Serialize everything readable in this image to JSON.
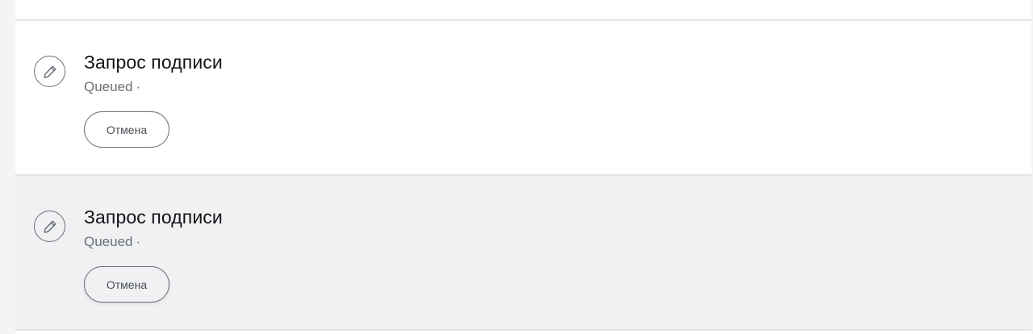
{
  "requests": [
    {
      "title": "Запрос подписи",
      "status": "Queued",
      "separator": "·",
      "cancel_label": "Отмена",
      "icon": "pencil-icon"
    },
    {
      "title": "Запрос подписи",
      "status": "Queued",
      "separator": "·",
      "cancel_label": "Отмена",
      "icon": "pencil-icon"
    }
  ],
  "colors": {
    "card_bg": "#ffffff",
    "hover_bg": "#f0f1f3",
    "divider": "#e3e4e6",
    "title": "#121417",
    "muted": "#6a6f77",
    "icon_stroke": "#6b6f76"
  }
}
